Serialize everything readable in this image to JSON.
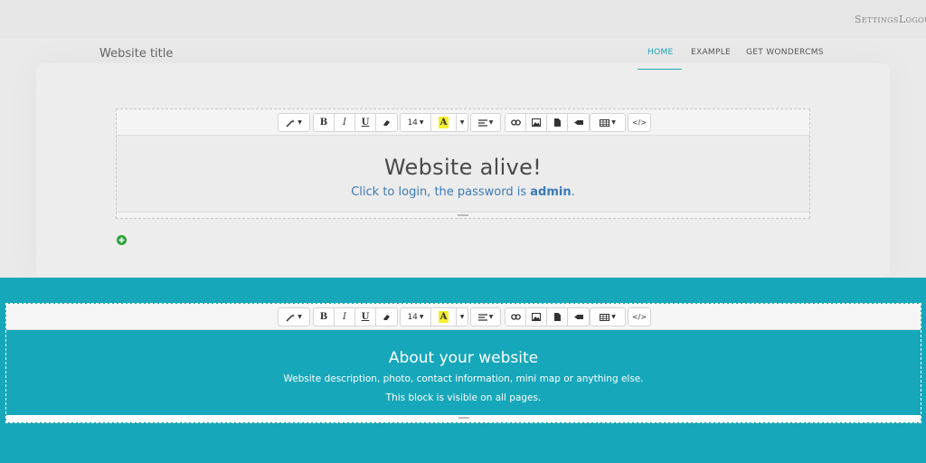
{
  "admin_bar": {
    "settings": "Settings",
    "logout": "Logout"
  },
  "header": {
    "site_title": "Website title",
    "nav": [
      {
        "label": "HOME",
        "active": true
      },
      {
        "label": "EXAMPLE",
        "active": false
      },
      {
        "label": "GET WONDERCMS",
        "active": false
      }
    ]
  },
  "toolbar": {
    "font_size": "14",
    "bold": "B",
    "italic": "I",
    "underline": "U",
    "highlight": "A",
    "code_view": "</>",
    "icons": [
      "magic-icon",
      "eraser-icon",
      "link-icon",
      "image-icon",
      "file-icon",
      "video-icon",
      "table-icon",
      "align-icon"
    ]
  },
  "main": {
    "title": "Website alive!",
    "subtitle_prefix": "Click to login, the password is ",
    "subtitle_password": "admin",
    "subtitle_suffix": "."
  },
  "footer": {
    "title": "About your website",
    "description": "Website description, photo, contact information, mini map or anything else.",
    "visibility": "This block is visible on all pages."
  },
  "colors": {
    "accent": "#16a7ba",
    "link": "#3b7ab5",
    "add": "#2a9f3a"
  }
}
